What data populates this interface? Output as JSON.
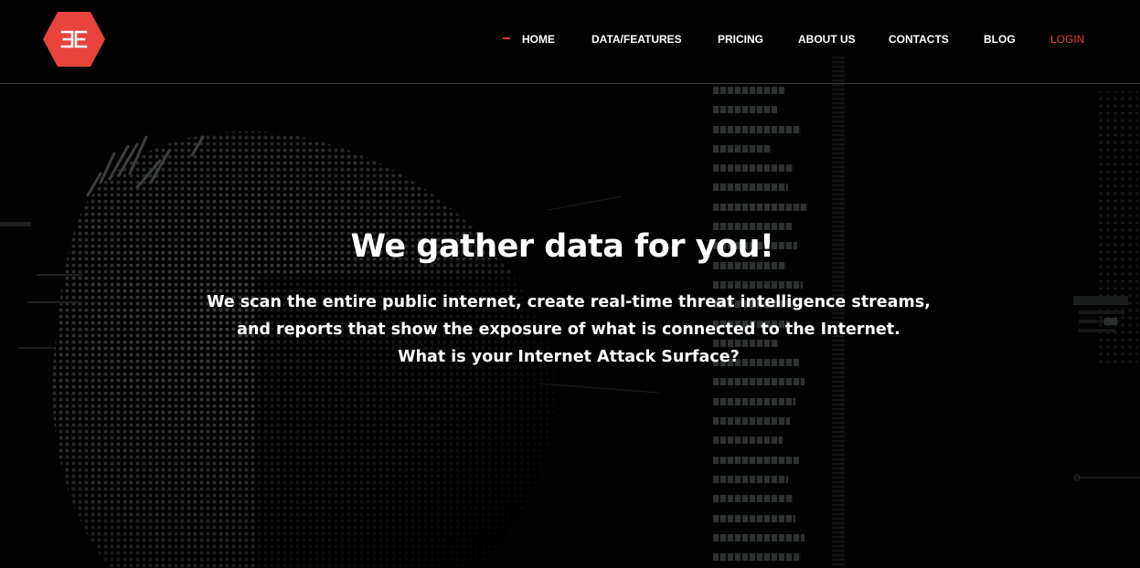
{
  "header": {
    "logo_icon": "brand-hexagon-logo",
    "nav": {
      "home": "HOME",
      "data_features": "DATA/FEATURES",
      "pricing": "PRICING",
      "about_us": "ABOUT US",
      "contacts": "CONTACTS",
      "blog": "BLOG",
      "login": "LOGIN"
    }
  },
  "hero": {
    "title": "We gather data for you!",
    "lines": [
      "We scan the entire public internet, create real-time threat intelligence streams,",
      "and reports that show the exposure of what is connected to the Internet.",
      "What is your Internet Attack Surface?"
    ]
  },
  "colors": {
    "background": "#020202",
    "brand_red": "#e8433c",
    "text": "#ffffff",
    "divider": "#3a3a3a"
  }
}
